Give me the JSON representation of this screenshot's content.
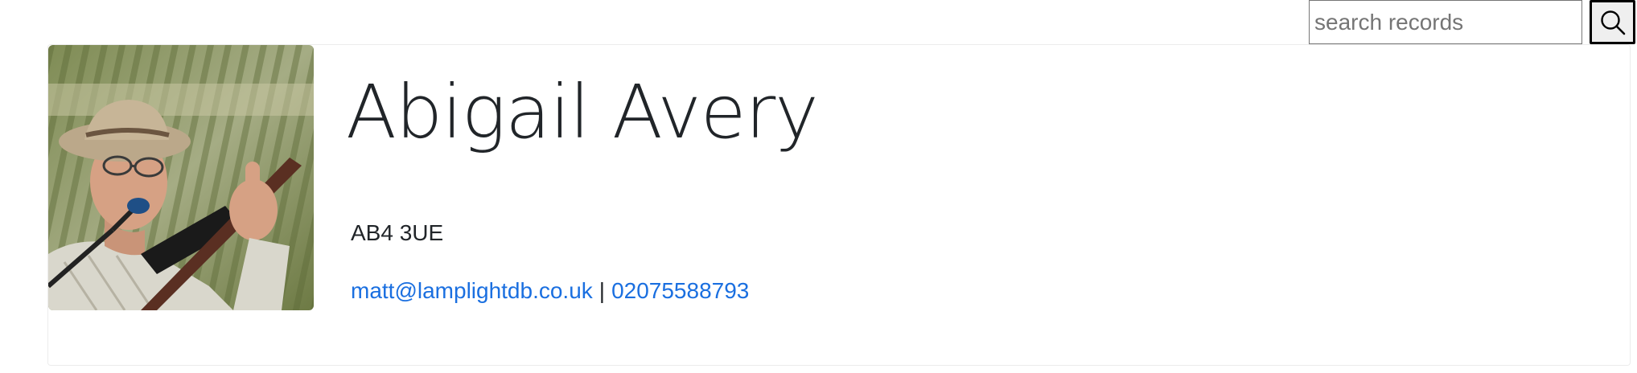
{
  "search": {
    "placeholder": "search records",
    "value": ""
  },
  "record": {
    "name": "Abigail Avery",
    "postcode": "AB4 3UE",
    "email": "matt@lamplightdb.co.uk",
    "separator": "|",
    "phone": "02075588793"
  },
  "icons": {
    "search_button": "search-icon",
    "photo": "profile-photo"
  },
  "colors": {
    "link": "#1a6fe0",
    "text": "#212529",
    "card_border": "#ececec"
  }
}
